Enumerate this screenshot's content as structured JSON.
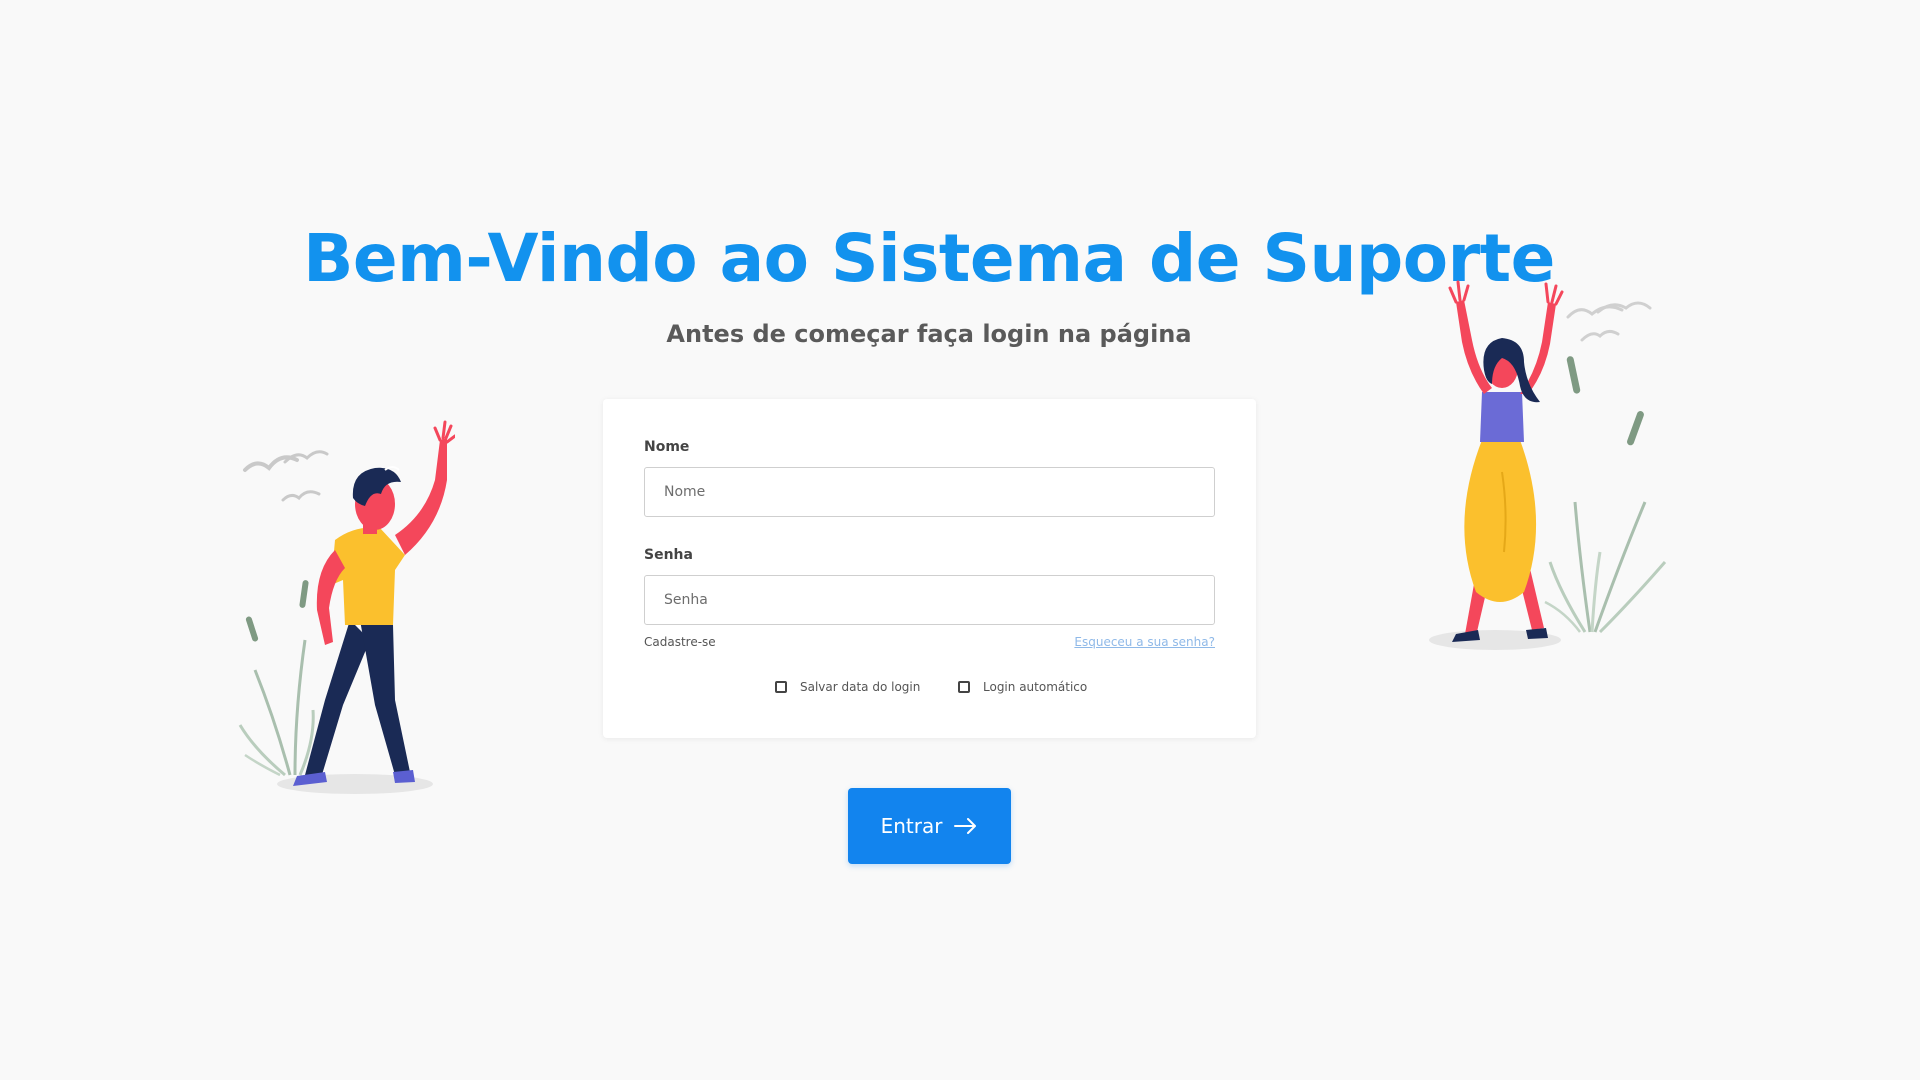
{
  "header": {
    "title": "Bem-Vindo ao Sistema de Suporte",
    "subtitle": "Antes de começar faça login na página"
  },
  "form": {
    "name_label": "Nome",
    "name_placeholder": "Nome",
    "password_label": "Senha",
    "password_placeholder": "Senha",
    "register_link": "Cadastre-se",
    "forgot_link": "Esqueceu a sua senha?",
    "save_login_label": "Salvar data do login",
    "auto_login_label": "Login automático"
  },
  "actions": {
    "enter_label": "Entrar",
    "enter_icon": "arrow-right-icon"
  },
  "colors": {
    "accent": "#1292ee",
    "button": "#1284ee",
    "background": "#f9f9f9"
  }
}
